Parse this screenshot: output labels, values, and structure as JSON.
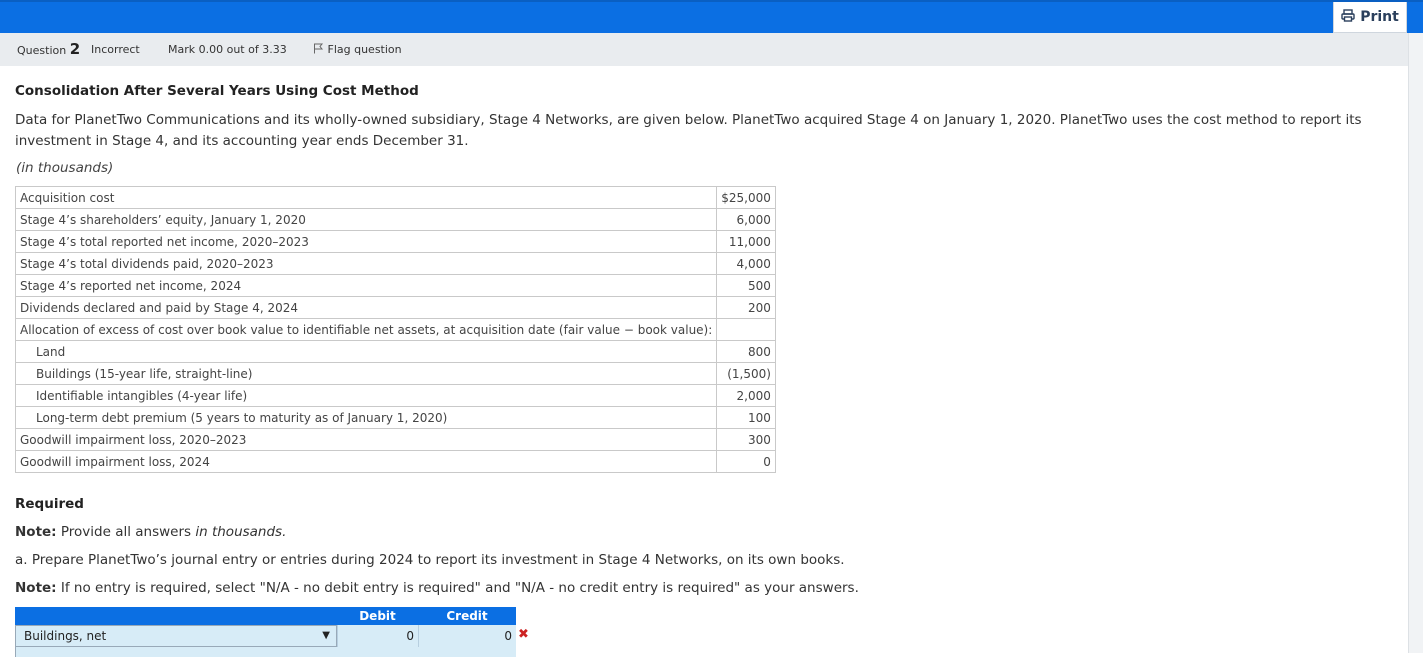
{
  "header": {
    "print_label": "Print",
    "question_word": "Question",
    "question_number": "2",
    "status": "Incorrect",
    "mark": "Mark 0.00 out of 3.33",
    "flag_label": "Flag question"
  },
  "problem": {
    "title": "Consolidation After Several Years Using Cost Method",
    "paragraph": "Data for PlanetTwo Communications and its wholly-owned subsidiary, Stage 4 Networks, are given below. PlanetTwo acquired Stage 4 on January 1, 2020. PlanetTwo uses the cost method to report its investment in Stage 4, and its accounting year ends December 31.",
    "units_note": "(in thousands)",
    "table": [
      {
        "label": "Acquisition cost",
        "value": "$25,000"
      },
      {
        "label": "Stage 4’s shareholders’ equity, January 1, 2020",
        "value": "6,000"
      },
      {
        "label": "Stage 4’s total reported net income, 2020–2023",
        "value": "11,000"
      },
      {
        "label": "Stage 4’s total dividends paid, 2020–2023",
        "value": "4,000"
      },
      {
        "label": "Stage 4’s reported net income, 2024",
        "value": "500"
      },
      {
        "label": "Dividends declared and paid by Stage 4, 2024",
        "value": "200"
      },
      {
        "label": "Allocation of excess of cost over book value to identifiable net assets, at acquisition date (fair value − book value):",
        "value": ""
      },
      {
        "label": "Land",
        "value": "800"
      },
      {
        "label": "Buildings (15-year life, straight-line)",
        "value": "(1,500)"
      },
      {
        "label": "Identifiable intangibles (4-year life)",
        "value": "2,000"
      },
      {
        "label": "Long-term debt premium (5 years to maturity as of January 1, 2020)",
        "value": "100"
      },
      {
        "label": "Goodwill impairment loss, 2020–2023",
        "value": "300"
      },
      {
        "label": "Goodwill impairment loss, 2024",
        "value": "0"
      }
    ]
  },
  "required": {
    "heading": "Required",
    "note1_bold": "Note:",
    "note1_text": " Provide all answers ",
    "note1_italic": "in thousands.",
    "part_a": "a. Prepare PlanetTwo’s journal entry or entries during 2024 to report its investment in Stage 4 Networks, on its own books.",
    "note2_bold": "Note:",
    "note2_text": " If no entry is required, select \"N/A - no debit entry is required\" and \"N/A - no credit entry is required\" as your answers."
  },
  "journal": {
    "debit_header": "Debit",
    "credit_header": "Credit",
    "rows": [
      {
        "account": "Buildings, net",
        "debit": "0",
        "credit": "0",
        "result": "incorrect"
      }
    ]
  },
  "colors": {
    "header_blue": "#0b6fe3",
    "input_bg": "#d7ecf7",
    "incorrect_red": "#cc2222"
  }
}
